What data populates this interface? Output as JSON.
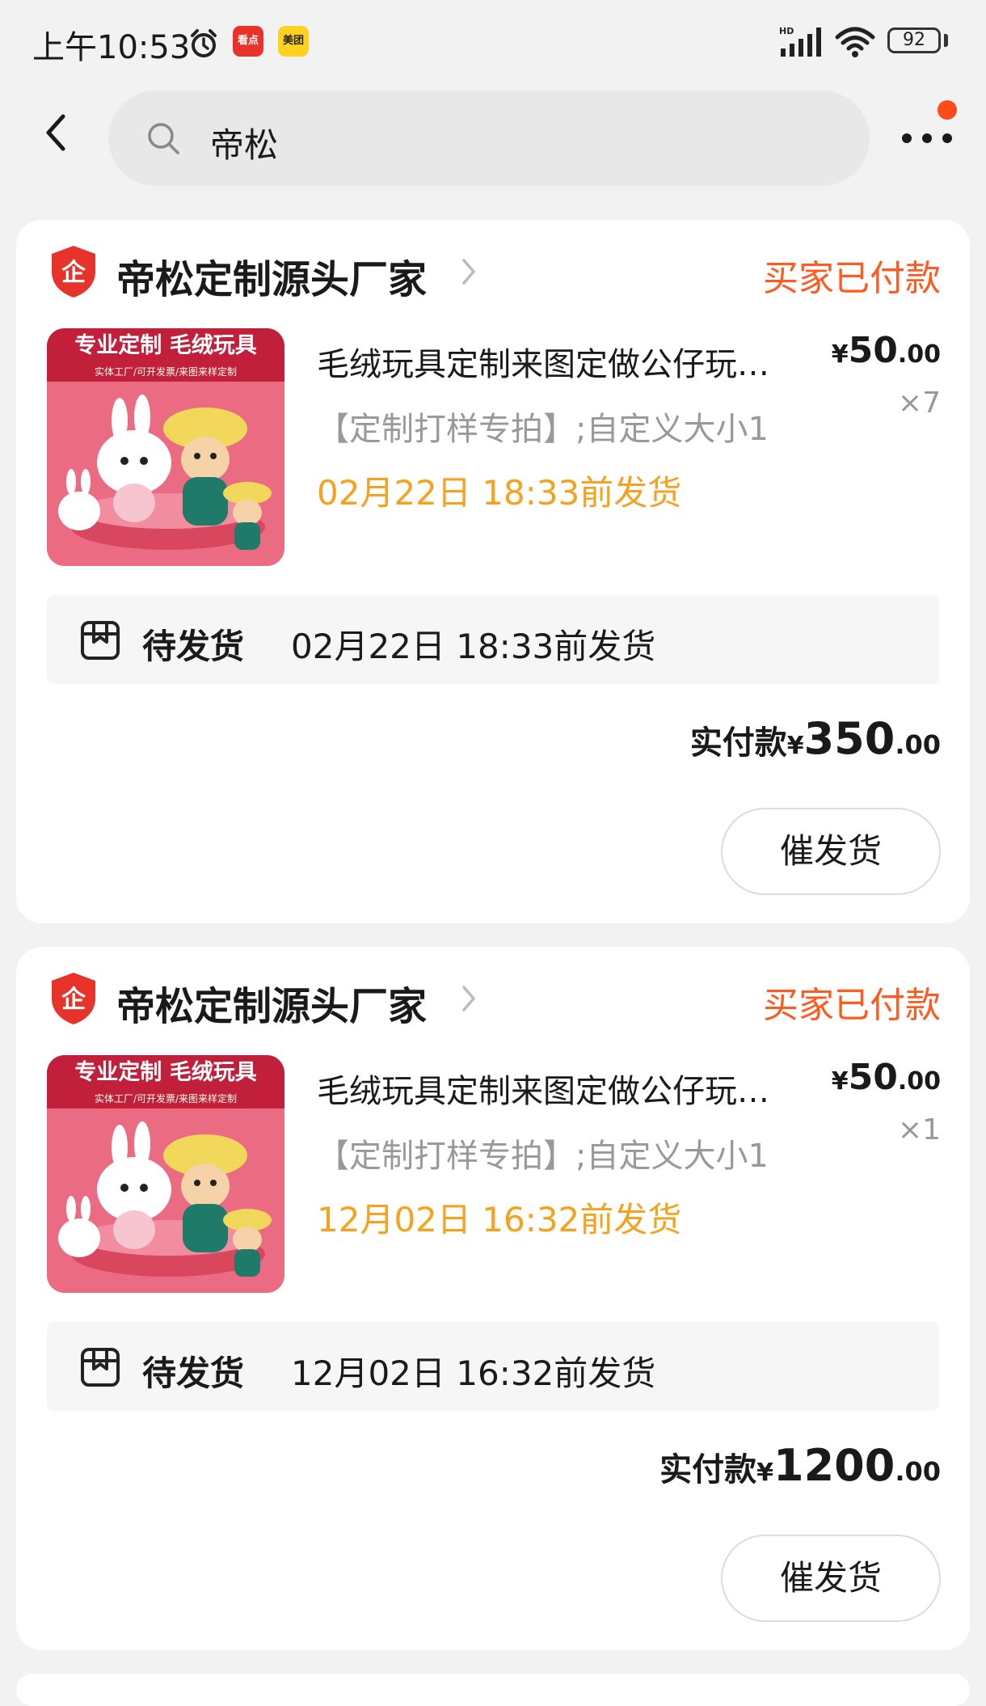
{
  "status_bar": {
    "time": "上午10:53",
    "app_icon_1": "看点",
    "app_icon_2": "美团",
    "battery": "92",
    "icons": [
      "alarm-icon",
      "signal-icon",
      "wifi-icon",
      "battery-icon"
    ]
  },
  "nav": {
    "search_text": "帝松",
    "icons": [
      "back-arrow-icon",
      "search-icon",
      "more-icon"
    ],
    "notification_color": "#ff4a1c"
  },
  "colors": {
    "status_orange": "#ff5a1f",
    "ship_time_yellow": "#f5a21e",
    "shop_badge_red": "#e8332a"
  },
  "orders": [
    {
      "shop_name": "帝松定制源头厂家",
      "status": "买家已付款",
      "thumb_banner": "专业定制 毛绒玩具",
      "thumb_sub": "实体工厂/可开发票/来图来样定制",
      "product_title": "毛绒玩具定制来图定做公仔玩…",
      "price_symbol": "¥",
      "price_int": "50",
      "price_dec": ".00",
      "quantity": "×7",
      "spec": "【定制打样专拍】;自定义大小1",
      "ship_by": "02月22日 18:33前发货",
      "ship_status": "待发货",
      "ship_deadline": "02月22日 18:33前发货",
      "paid_label": "实付款",
      "paid_symbol": "¥",
      "paid_int": "350",
      "paid_dec": ".00",
      "urge_label": "催发货"
    },
    {
      "shop_name": "帝松定制源头厂家",
      "status": "买家已付款",
      "thumb_banner": "专业定制 毛绒玩具",
      "thumb_sub": "实体工厂/可开发票/来图来样定制",
      "product_title": "毛绒玩具定制来图定做公仔玩…",
      "price_symbol": "¥",
      "price_int": "50",
      "price_dec": ".00",
      "quantity": "×1",
      "spec": "【定制打样专拍】;自定义大小1",
      "ship_by": "12月02日 16:32前发货",
      "ship_status": "待发货",
      "ship_deadline": "12月02日 16:32前发货",
      "paid_label": "实付款",
      "paid_symbol": "¥",
      "paid_int": "1200",
      "paid_dec": ".00",
      "urge_label": "催发货"
    }
  ]
}
